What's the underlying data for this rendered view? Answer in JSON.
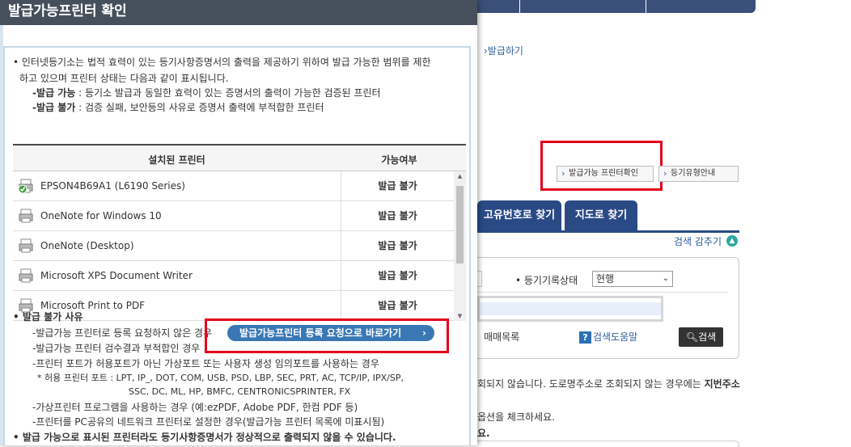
{
  "popup": {
    "title": "발급가능프린터 확인",
    "intro_line1": "• 인터넷등기소는 법적 효력이 있는 등기사항증명서의 출력을 제공하기 위하여 발급 가능한 범위를 제한",
    "intro_line2": "하고 있으며 프린터 상태는 다음과 같이 표시됩니다.",
    "def_ok_label": "-발급 가능",
    "def_ok_text": " : 등기소 발급과 동일한 효력이 있는 증명서의 출력이 가능한 검증된 프린터",
    "def_no_label": "-발급 불가",
    "def_no_text": " : 검증 실패, 보안등의 사유로 증명서 출력에 부적합한 프린터",
    "table": {
      "col_printer": "설치된 프린터",
      "col_status": "가능여부",
      "rows": [
        {
          "name": "EPSON4B69A1 (L6190 Series)",
          "status": "발급 불가",
          "icon": "default-printer-check-icon"
        },
        {
          "name": "OneNote for Windows 10",
          "status": "발급 불가",
          "icon": "printer-icon"
        },
        {
          "name": "OneNote (Desktop)",
          "status": "발급 불가",
          "icon": "printer-icon"
        },
        {
          "name": "Microsoft XPS Document Writer",
          "status": "발급 불가",
          "icon": "printer-icon"
        },
        {
          "name": "Microsoft Print to PDF",
          "status": "발급 불가",
          "icon": "printer-icon"
        }
      ]
    },
    "reasons_title": "• 발급 불가 사유",
    "reason1": "-발급가능 프린터로 등록 요청하지 않은 경우",
    "register_button": "발급가능프린터 등록 요청으로 바로가기",
    "reason2": "-발급가능 프린터 검수결과 부적합인 경우",
    "reason3": "-프린터 포트가 허용포트가 아닌 가상포트 또는 사용자 생성 임의포트를 사용하는 경우",
    "ports1": "* 허용 프린터 포트 : LPT, IP_, DOT, COM, USB, PSD, LBP, SEC, PRT, AC, TCP/IP, IPX/SP,",
    "ports2": "SSC, DC, ML, HP, BMFC, CENTRONICSPRINTER, FX",
    "reason4": "-가상프린터 프로그램을 사용하는 경우 (예:ezPDF, Adobe PDF, 한컴 PDF 등)",
    "reason5": "-프린터를 PC공유의 네트워크 프린터로 설정한 경우(발급가능 프린터 목록에 미표시됨)",
    "warning": "• 발급 가능으로 표시된 프린터라도 등기사항증명서가 정상적으로 출력되지 않을 수 있습니다."
  },
  "background": {
    "breadcrumb": "›발급하기",
    "check_printer_button": "발급가능 프린터확인",
    "guide_button": "등기유형안내",
    "tabs": [
      "고유번호로 찾기",
      "지도로 찾기"
    ],
    "hide_search": "검색 감추기",
    "status_label": "• 등기기록상태",
    "status_value": "현행",
    "trade_list": "매매목록",
    "help": "검색도움말",
    "search": "검색",
    "notice1_a": "회되지 않습니다. 도로명주소로 조회되지 않는 경우에는 ",
    "notice1_b": "지번주소",
    "notice2": "옵션을 체크하세요.",
    "notice3": "요."
  },
  "colors": {
    "title_bar": "#45505c",
    "accent_blue": "#3a78b5",
    "tab_blue": "#2a4a86",
    "highlight_red": "#e3001b"
  }
}
